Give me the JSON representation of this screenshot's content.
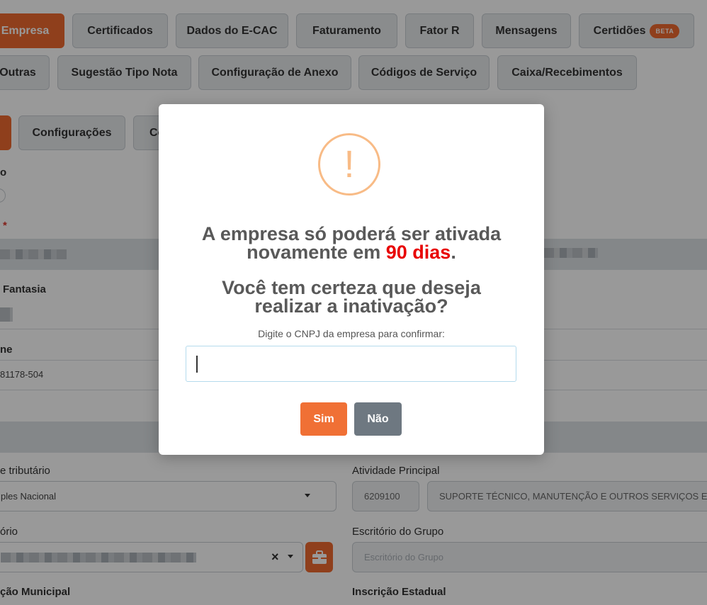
{
  "top_tabs_row1": [
    {
      "label": "Empresa",
      "active": true
    },
    {
      "label": "Certificados"
    },
    {
      "label": "Dados do E-CAC"
    },
    {
      "label": "Faturamento"
    },
    {
      "label": "Fator R"
    },
    {
      "label": "Mensagens"
    },
    {
      "label": "Certidões",
      "badge": "BETA"
    }
  ],
  "top_tabs_row2": [
    {
      "label": "Outras"
    },
    {
      "label": "Sugestão Tipo Nota"
    },
    {
      "label": "Configuração de Anexo"
    },
    {
      "label": "Códigos de Serviço"
    },
    {
      "label": "Caixa/Recebimentos"
    }
  ],
  "sub_tabs": [
    {
      "label": "",
      "active": true
    },
    {
      "label": "Configurações"
    },
    {
      "label": "Co"
    }
  ],
  "form": {
    "label_o": "o",
    "required_star": "*",
    "fantasia_label": "Fantasia",
    "fone_label": "ne",
    "fone_value": "81178-504",
    "regime_label": "e tributário",
    "regime_value": "ples Nacional",
    "atividade_label": "Atividade Principal",
    "atividade_code": "6209100",
    "atividade_desc": "SUPORTE TÉCNICO, MANUTENÇÃO E OUTROS SERVIÇOS EM T",
    "escritorio_label": "ório",
    "escritorio_clear": "×",
    "escritorio_grupo_label": "Escritório do Grupo",
    "escritorio_grupo_placeholder": "Escritório do Grupo",
    "inscricao_municipal_label": "ção Municipal",
    "inscricao_estadual_label": "Inscrição Estadual"
  },
  "modal": {
    "icon": "warning-exclamation-icon",
    "icon_glyph": "!",
    "title_line1": "A empresa só poderá ser ativada",
    "title_line2_pre": "novamente em ",
    "title_line2_highlight": "90 dias",
    "title_line2_post": ".",
    "question_line1": "Você tem certeza que deseja",
    "question_line2": "realizar a inativação?",
    "input_label": "Digite o CNPJ da empresa para confirmar:",
    "input_value": "",
    "confirm_label": "Sim",
    "cancel_label": "Não"
  },
  "colors": {
    "accent": "#ef6a2f",
    "highlight": "#e80000",
    "warning_icon": "#f8bb86",
    "cancel_button": "#6e7881"
  }
}
